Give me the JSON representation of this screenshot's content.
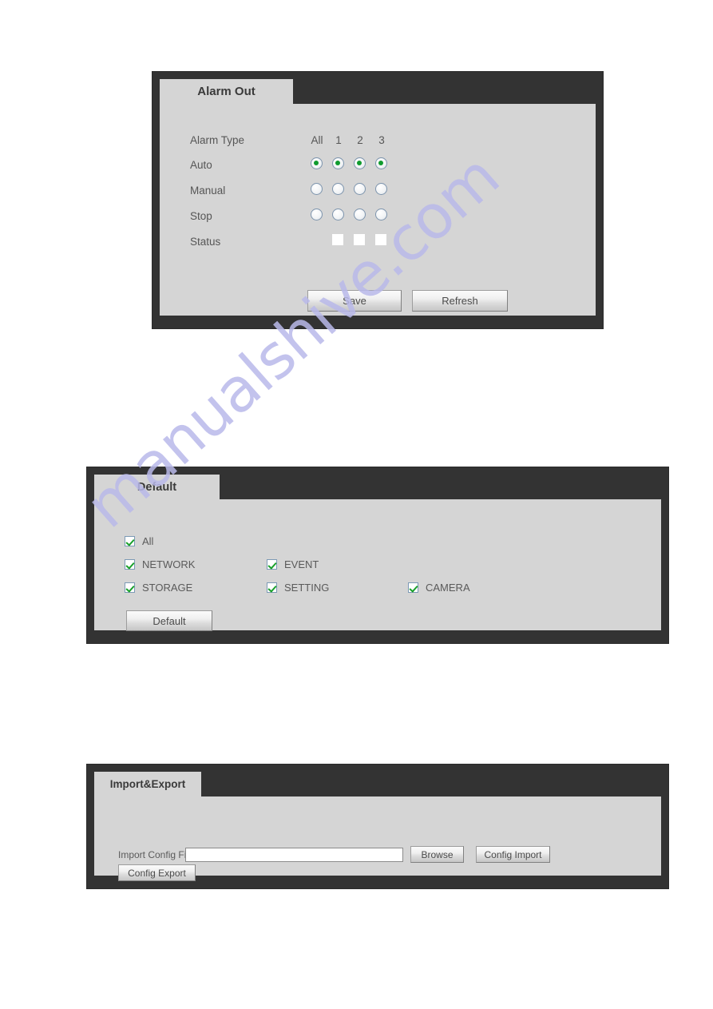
{
  "watermark": {
    "text": "manualshive.com",
    "color": "#b9b9ea"
  },
  "theme": {
    "panel_frame": "#333333",
    "panel_face": "#d5d5d5",
    "label_color": "#565656",
    "radio_dot": "#0f9b2e",
    "check_color": "#18a02a"
  },
  "panels": {
    "alarm_out": {
      "tab_label": "Alarm Out",
      "columns": [
        "All",
        "1",
        "2",
        "3"
      ],
      "column_header_label": "Alarm Type",
      "rows": [
        {
          "label": "Auto",
          "states": [
            true,
            true,
            true,
            true
          ]
        },
        {
          "label": "Manual",
          "states": [
            false,
            false,
            false,
            false
          ]
        },
        {
          "label": "Stop",
          "states": [
            false,
            false,
            false,
            false
          ]
        }
      ],
      "status": {
        "label": "Status",
        "boxes": [
          false,
          false,
          false
        ]
      },
      "buttons": {
        "save": "Save",
        "refresh": "Refresh"
      }
    },
    "default": {
      "tab_label": "Default",
      "checkboxes": [
        {
          "label": "All",
          "checked": true,
          "col": 0,
          "row": 0
        },
        {
          "label": "NETWORK",
          "checked": true,
          "col": 0,
          "row": 1
        },
        {
          "label": "EVENT",
          "checked": true,
          "col": 1,
          "row": 1
        },
        {
          "label": "STORAGE",
          "checked": true,
          "col": 0,
          "row": 2
        },
        {
          "label": "SETTING",
          "checked": true,
          "col": 1,
          "row": 2
        },
        {
          "label": "CAMERA",
          "checked": true,
          "col": 2,
          "row": 2
        }
      ],
      "buttons": {
        "default": "Default"
      }
    },
    "import_export": {
      "tab_label": "Import&Export",
      "field_label": "Import Config File",
      "input_value": "",
      "input_placeholder": "",
      "buttons": {
        "browse": "Browse",
        "config_import": "Config Import",
        "config_export": "Config Export"
      }
    }
  }
}
